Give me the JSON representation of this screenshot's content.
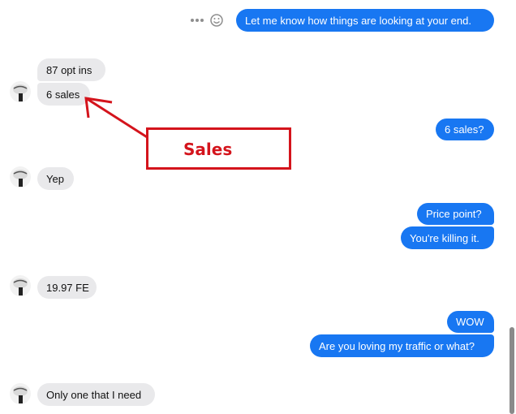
{
  "conversation": {
    "messages": [
      {
        "sender": "me",
        "text": "Let me know how things are looking at your end."
      },
      {
        "sender": "other",
        "text": "87 opt ins"
      },
      {
        "sender": "other",
        "text": "6 sales"
      },
      {
        "sender": "me",
        "text": "6 sales?"
      },
      {
        "sender": "other",
        "text": "Yep"
      },
      {
        "sender": "me",
        "text": "Price point?"
      },
      {
        "sender": "me",
        "text": "You're killing it."
      },
      {
        "sender": "other",
        "text": "19.97 FE"
      },
      {
        "sender": "me",
        "text": "WOW"
      },
      {
        "sender": "me",
        "text": "Are you loving my traffic or what?"
      },
      {
        "sender": "other",
        "text": "Only one that I need"
      }
    ]
  },
  "annotation": {
    "label": "Sales",
    "color": "#d4141c"
  },
  "icons": {
    "more": "more-options-icon",
    "react": "emoji-reaction-icon",
    "avatar": "contact-avatar"
  },
  "colors": {
    "outgoing_bubble": "#1877f2",
    "incoming_bubble": "#e9e9eb"
  }
}
